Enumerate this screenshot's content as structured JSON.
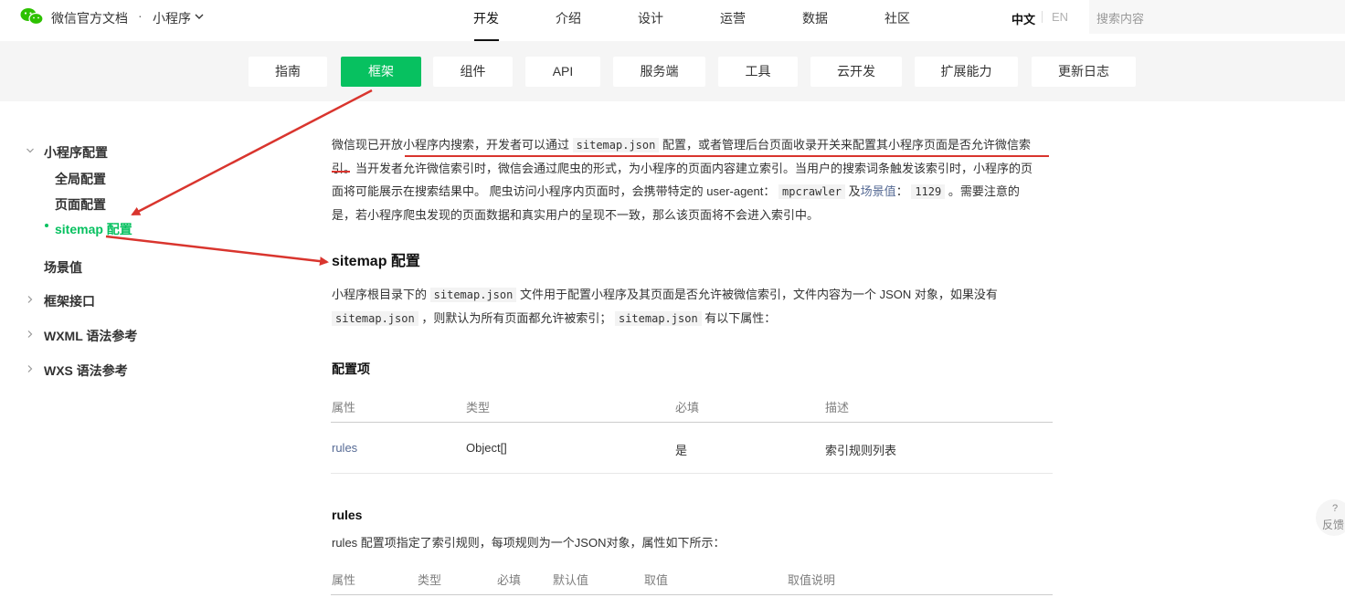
{
  "header": {
    "brand": "微信官方文档",
    "separator": "·",
    "product": "小程序",
    "nav": [
      "开发",
      "介绍",
      "设计",
      "运营",
      "数据",
      "社区"
    ],
    "active_nav": "开发",
    "lang_zh": "中文",
    "lang_en": "EN",
    "search_placeholder": "搜索内容"
  },
  "tabs": [
    "指南",
    "框架",
    "组件",
    "API",
    "服务端",
    "工具",
    "云开发",
    "扩展能力",
    "更新日志"
  ],
  "active_tab": "框架",
  "sidebar": {
    "section1": "小程序配置",
    "sub": [
      "全局配置",
      "页面配置",
      "sitemap 配置"
    ],
    "item_scene": "场景值",
    "item_framework": "框架接口",
    "item_wxml": "WXML 语法参考",
    "item_wxs": "WXS 语法参考"
  },
  "intro": {
    "l1a": "微信现已开放小程序内搜索，开发者可以通过",
    "l1code": "sitemap.json",
    "l1b": "配置，或者管理后台页面收录开关来配置其小程序页面是否允许微信索",
    "l2": "引。当开发者允许微信索引时，微信会通过爬虫的形式，为小程序的页面内容建立索引。当用户的搜索词条触发该索引时，小程序的页",
    "l3a": "面将可能展示在搜索结果中。 爬虫访问小程序内页面时，会携带特定的 user-agent：",
    "l3code1": "mpcrawler",
    "l3b": "及",
    "l3link": "场景值",
    "l3c": "：",
    "l3code2": "1129",
    "l3d": "。需要注意的",
    "l4": "是，若小程序爬虫发现的页面数据和真实用户的呈现不一致，那么该页面将不会进入索引中。"
  },
  "sitemap_section": {
    "title": "sitemap 配置",
    "p1a": "小程序根目录下的",
    "p1code": "sitemap.json",
    "p1b": "文件用于配置小程序及其页面是否允许被微信索引，文件内容为一个 JSON 对象，如果没有",
    "p2code": "sitemap.json",
    "p2b": "，则默认为所有页面都允许被索引；",
    "p2code2": "sitemap.json",
    "p2c": "有以下属性："
  },
  "config_table": {
    "title": "配置项",
    "headers": [
      "属性",
      "类型",
      "必填",
      "描述"
    ],
    "rows": [
      [
        "rules",
        "Object[]",
        "是",
        "索引规则列表"
      ]
    ]
  },
  "rules_section": {
    "title": "rules",
    "desc": "rules 配置项指定了索引规则，每项规则为一个JSON对象，属性如下所示：",
    "headers": [
      "属性",
      "类型",
      "必填",
      "默认值",
      "取值",
      "取值说明"
    ]
  },
  "feedback": {
    "icon": "?",
    "label": "反馈"
  },
  "colors": {
    "accent": "#07c160",
    "annotation": "#d9352e",
    "link": "#576b95"
  }
}
